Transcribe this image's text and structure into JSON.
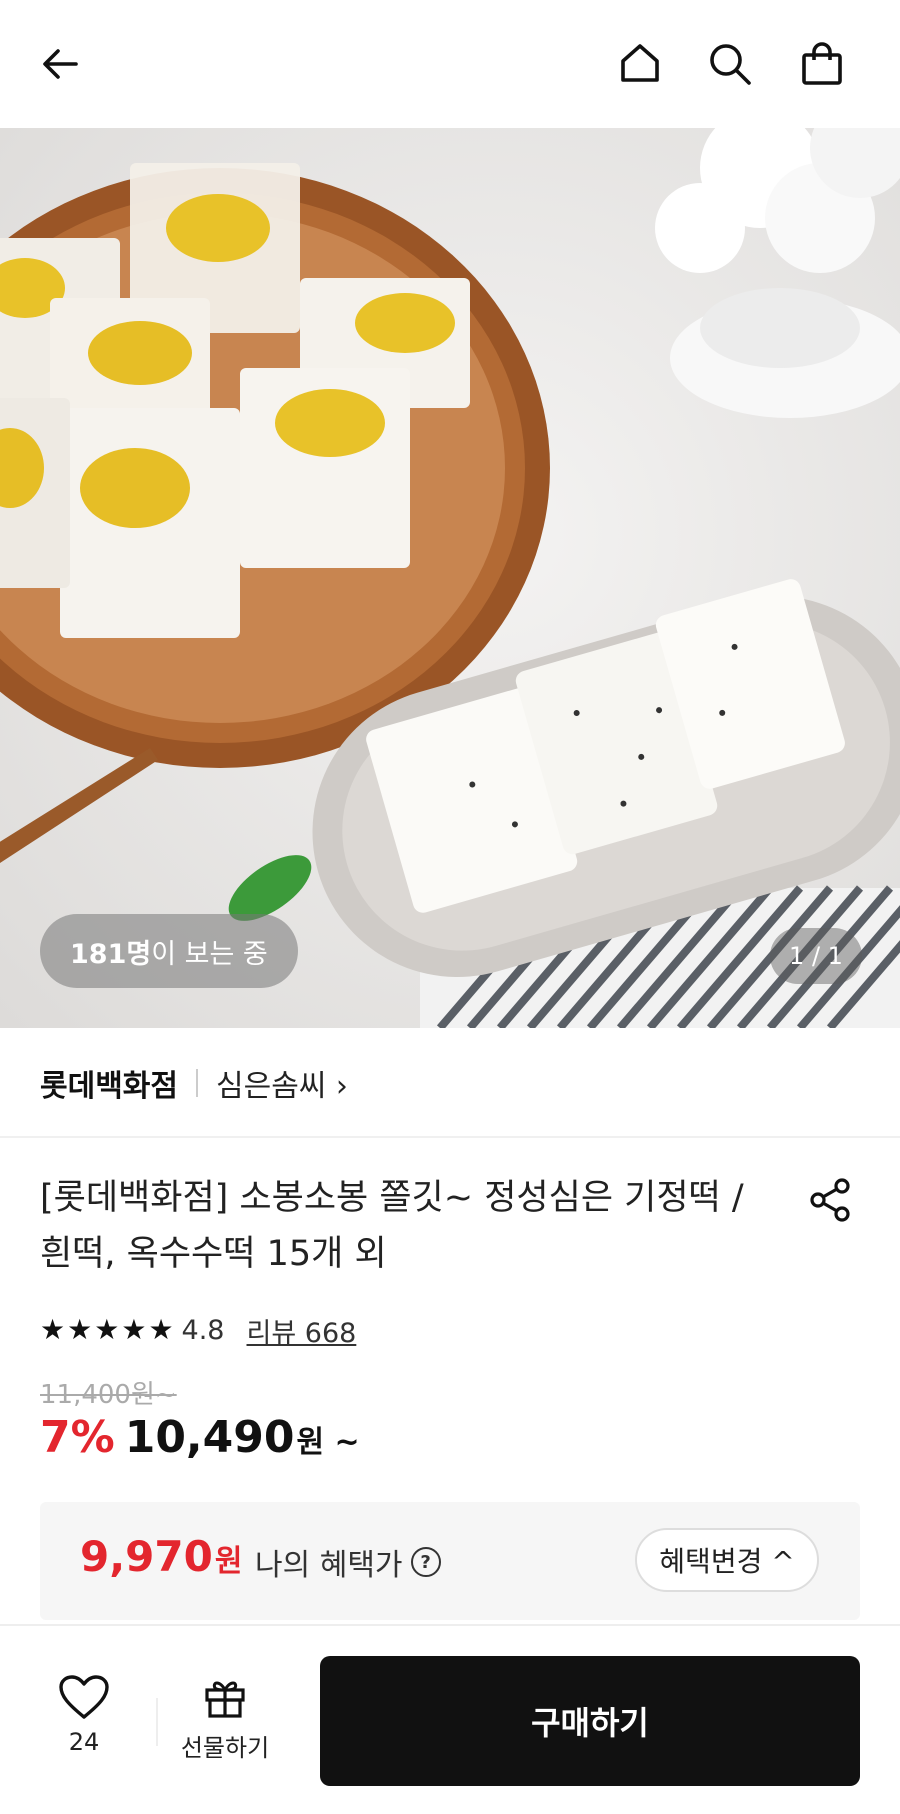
{
  "header": {
    "back_icon": "arrow-left-icon",
    "home_icon": "home-icon",
    "search_icon": "search-icon",
    "cart_icon": "shopping-bag-icon"
  },
  "hero": {
    "viewers_count": "181명",
    "viewers_suffix": "이 보는 중",
    "pager": "1 / 1"
  },
  "seller": {
    "brand": "롯데백화점",
    "store": "심은솜씨 ›"
  },
  "product": {
    "title": "[롯데백화점] 소봉소봉 쫄깃~ 정성심은 기정떡 / 흰떡, 옥수수떡 15개 외",
    "rating": "4.8",
    "rating_stars": 5,
    "review_text": "리뷰 668",
    "original_price": "11,400원~",
    "discount": "7%",
    "price": "10,490",
    "price_suffix": "원 ~"
  },
  "benefit": {
    "price": "9,970",
    "unit": "원",
    "label": "나의 혜택가",
    "help": "?",
    "button": "혜택변경 ^"
  },
  "bottom": {
    "like_count": "24",
    "gift_label": "선물하기",
    "buy_label": "구매하기"
  },
  "colors": {
    "accent_red": "#e3262e",
    "buy_button": "#111111"
  }
}
